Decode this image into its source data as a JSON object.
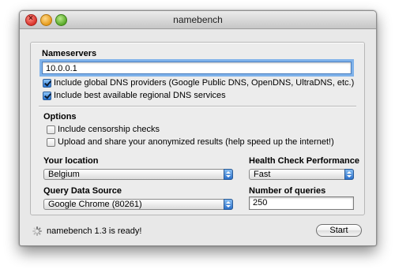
{
  "window": {
    "title": "namebench"
  },
  "nameservers": {
    "label": "Nameservers",
    "value": "10.0.0.1",
    "include_global": {
      "label": "Include global DNS providers (Google Public DNS, OpenDNS, UltraDNS, etc.)",
      "checked": true
    },
    "include_regional": {
      "label": "Include best available regional DNS services",
      "checked": true
    }
  },
  "options": {
    "label": "Options",
    "censorship": {
      "label": "Include censorship checks",
      "checked": false
    },
    "upload": {
      "label": "Upload and share your anonymized results (help speed up the internet!)",
      "checked": false
    }
  },
  "location": {
    "label": "Your location",
    "value": "Belgium"
  },
  "health": {
    "label": "Health Check Performance",
    "value": "Fast"
  },
  "query_source": {
    "label": "Query Data Source",
    "value": "Google Chrome (80261)"
  },
  "num_queries": {
    "label": "Number of queries",
    "value": "250"
  },
  "status": {
    "text": "namebench 1.3 is ready!"
  },
  "actions": {
    "start_label": "Start"
  },
  "colors": {
    "focus_ring": "#7fb2ea",
    "checkbox_on": "#2a78d6",
    "popup_accent": "#2b6fc9"
  }
}
